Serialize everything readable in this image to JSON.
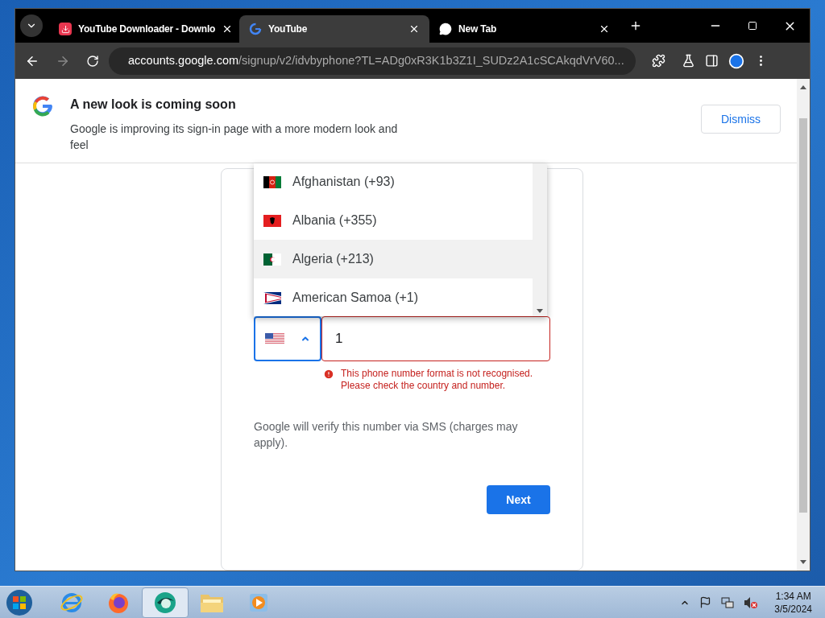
{
  "browser": {
    "tabs": [
      {
        "title": "YouTube Downloader - Downlo",
        "selected": false
      },
      {
        "title": "YouTube",
        "selected": true
      },
      {
        "title": "New Tab",
        "selected": false
      }
    ],
    "address": {
      "domain": "accounts.google.com",
      "path": "/signup/v2/idvbyphone?TL=ADg0xR3K1b3Z1I_SUDz2A1cSCAkqdVrV60..."
    }
  },
  "banner": {
    "title": "A new look is coming soon",
    "text": "Google is improving its sign-in page with a more modern look and feel",
    "button": "Dismiss"
  },
  "country_menu": {
    "options": [
      {
        "label": "Afghanistan (+93)",
        "highlighted": false
      },
      {
        "label": "Albania (+355)",
        "highlighted": false
      },
      {
        "label": "Algeria (+213)",
        "highlighted": true
      },
      {
        "label": "American Samoa (+1)",
        "highlighted": false
      }
    ]
  },
  "country_select": {
    "expanded": true
  },
  "phone_field": {
    "value": "1",
    "error": "This phone number format is not recognised. Please check the country and number."
  },
  "info": "Google will verify this number via SMS (charges may apply).",
  "next_button": "Next",
  "taskbar": {
    "apps": [
      {
        "selected": false
      },
      {
        "selected": false
      },
      {
        "selected": true
      },
      {
        "selected": false
      },
      {
        "selected": false
      }
    ],
    "time": "1:34 AM",
    "date": "3/5/2024"
  }
}
